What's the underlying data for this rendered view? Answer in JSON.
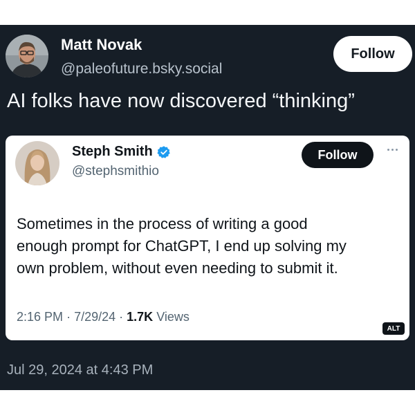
{
  "post": {
    "author_name": "Matt Novak",
    "author_handle": "@paleofuture.bsky.social",
    "follow_label": "Follow",
    "text": "AI folks have now discovered “thinking”",
    "date": "Jul 29, 2024 at 4:43 PM",
    "background_color": "#161e27"
  },
  "quoted_post": {
    "author_name": "Steph Smith",
    "author_handle": "@stephsmithio",
    "verified": true,
    "follow_label": "Follow",
    "text_lines": [
      "Sometimes in the process of writing a good",
      "enough prompt for ChatGPT, I end up solving my",
      "own problem, without even needing to submit it."
    ],
    "time": "2:16 PM",
    "date": "7/29/24",
    "views_count": "1.7K",
    "views_label": "Views",
    "alt_label": "ALT",
    "verified_color": "#1d9bf0"
  }
}
